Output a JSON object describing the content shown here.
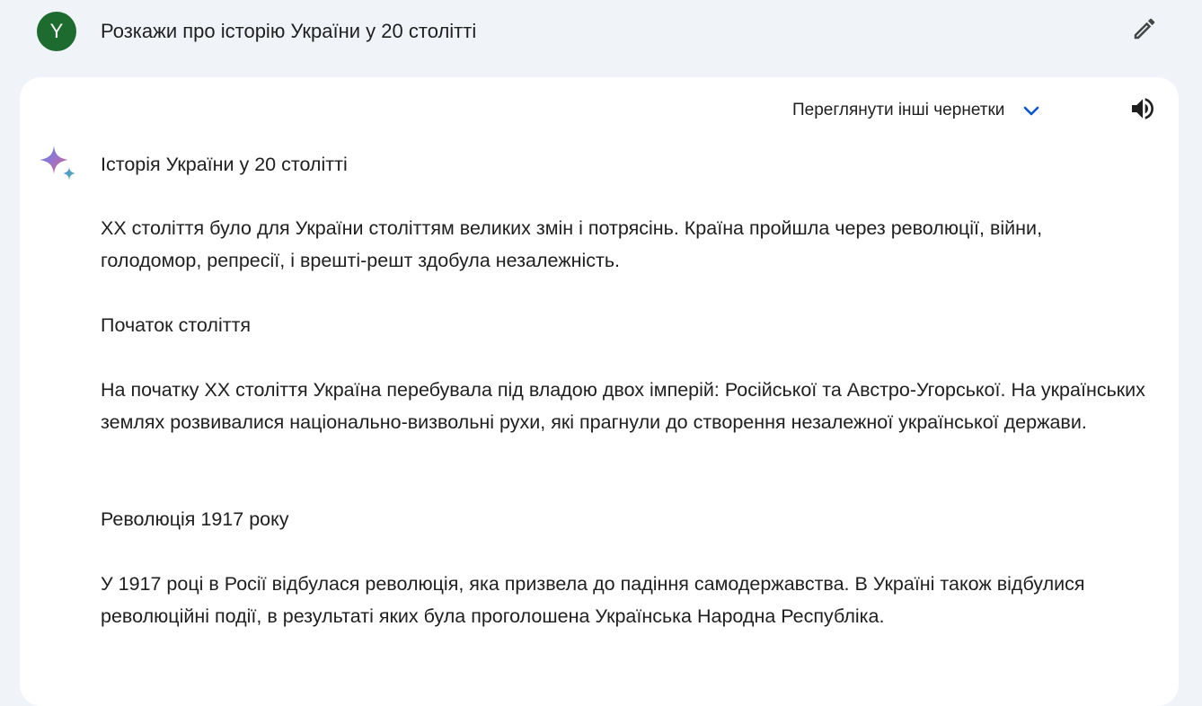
{
  "prompt": {
    "avatar_letter": "Y",
    "text": "Розкажи про історію України у 20 столітті"
  },
  "toolbar": {
    "drafts_label": "Переглянути інші чернетки"
  },
  "response": {
    "title": "Історія України у 20 столітті",
    "intro": "ХХ століття було для України століттям великих змін і потрясінь. Країна пройшла через революції, війни, голодомор, репресії, і врешті-решт здобула незалежність.",
    "sections": [
      {
        "heading": "Початок століття",
        "body": "На початку ХХ століття Україна перебувала під владою двох імперій: Російської та Австро-Угорської. На українських землях розвивалися національно-визвольні рухи, які прагнули до створення незалежної української держави."
      },
      {
        "heading": "Революція 1917 року",
        "body": "У 1917 році в Росії відбулася революція, яка призвела до падіння самодержавства. В Україні також відбулися революційні події, в результаті яких була проголошена Українська Народна Республіка."
      }
    ]
  },
  "icons": {
    "edit": "pencil-icon",
    "drafts_toggle": "chevron-down-icon",
    "read_aloud": "speaker-icon",
    "assistant": "sparkle-icon"
  },
  "colors": {
    "background": "#f0f4f9",
    "card": "#ffffff",
    "avatar": "#1e6b2f",
    "chevron": "#0b57d0"
  }
}
